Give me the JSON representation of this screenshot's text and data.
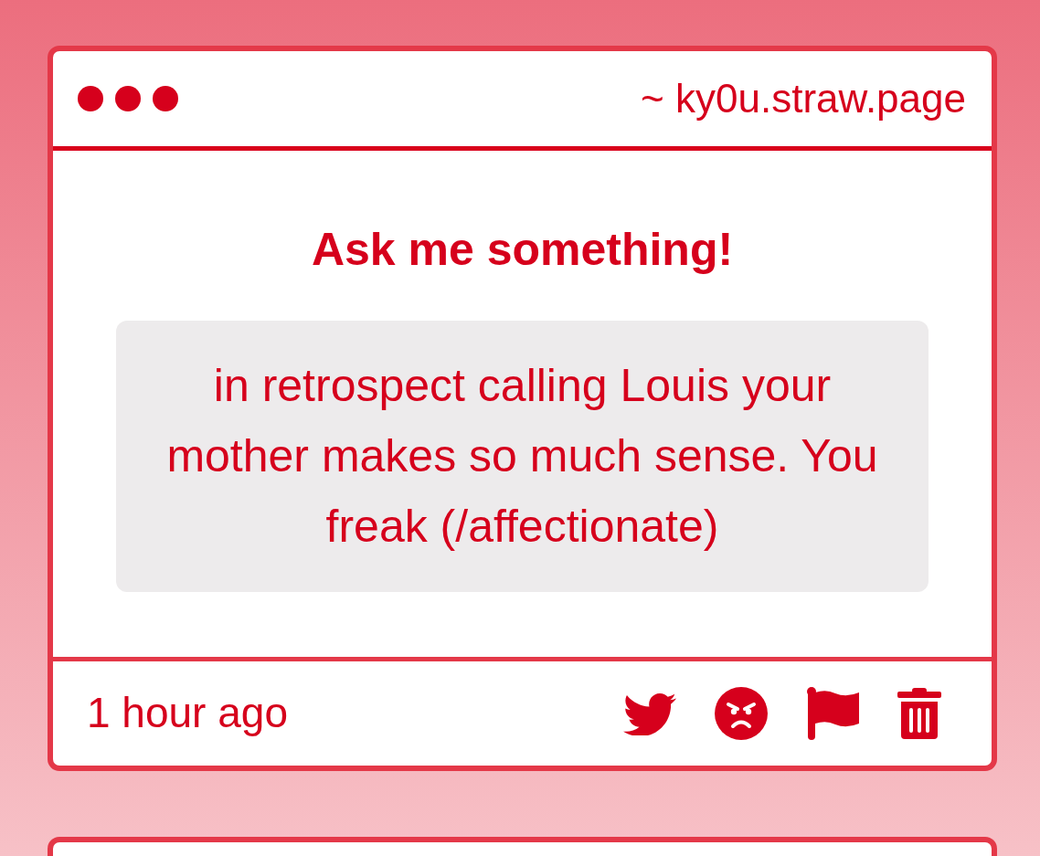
{
  "window": {
    "address": "~ ky0u.straw.page"
  },
  "post": {
    "heading": "Ask me something!",
    "question": "in retrospect calling Louis your mother makes so much sense. You freak (/affectionate)",
    "time": "1 hour ago"
  }
}
